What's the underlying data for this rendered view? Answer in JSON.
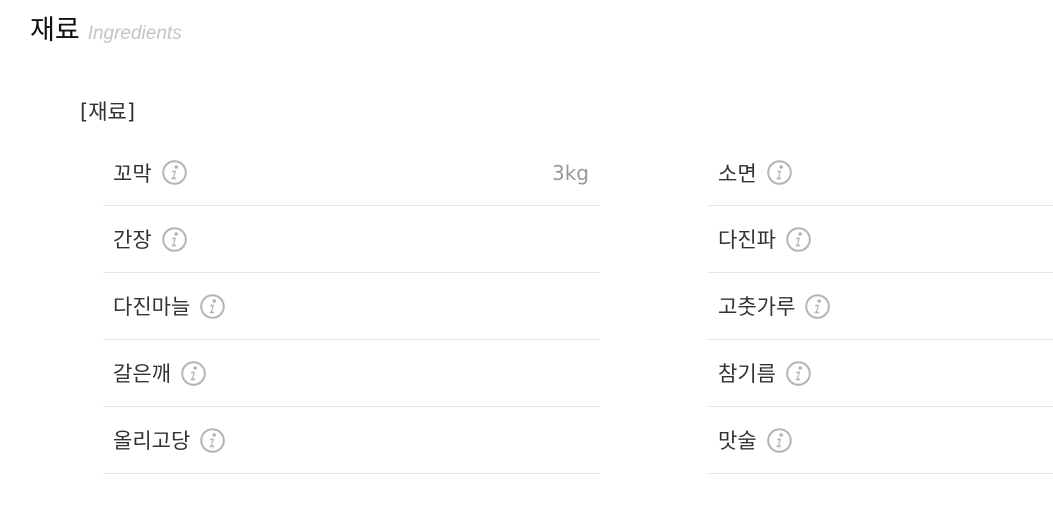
{
  "section": {
    "title": "재료",
    "subtitle": "Ingredients"
  },
  "group": {
    "label": "[재료]"
  },
  "info_icon": "info-circle-icon",
  "colors": {
    "text": "#333333",
    "subtitle": "#c4c4c4",
    "quantity": "#999999",
    "icon": "#b5b5b5",
    "divider": "#e5e5e5"
  },
  "ingredients": {
    "left": [
      {
        "name": "꼬막",
        "amount": "3kg"
      },
      {
        "name": "간장",
        "amount": ""
      },
      {
        "name": "다진마늘",
        "amount": ""
      },
      {
        "name": "갈은깨",
        "amount": ""
      },
      {
        "name": "올리고당",
        "amount": ""
      }
    ],
    "right": [
      {
        "name": "소면",
        "amount": ""
      },
      {
        "name": "다진파",
        "amount": ""
      },
      {
        "name": "고춧가루",
        "amount": ""
      },
      {
        "name": "참기름",
        "amount": ""
      },
      {
        "name": "맛술",
        "amount": ""
      }
    ]
  }
}
